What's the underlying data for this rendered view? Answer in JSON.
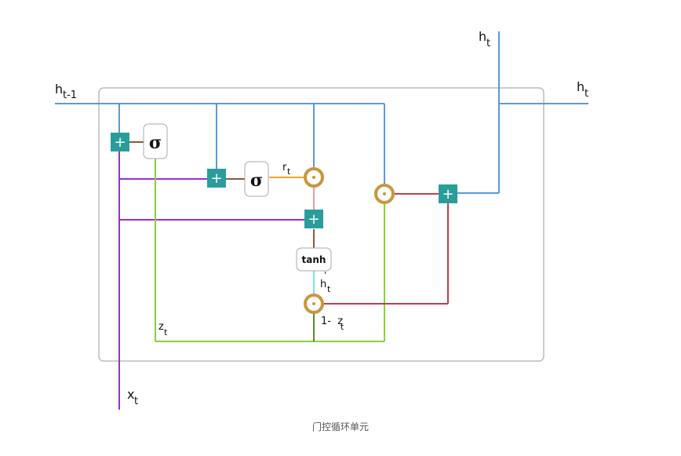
{
  "labels": {
    "h_prev_main": "h",
    "h_prev_sub": "t-1",
    "h_top_main": "h",
    "h_top_sub": "t",
    "h_right_main": "h",
    "h_right_sub": "t",
    "x_main": "x",
    "x_sub": "t",
    "r_main": "r",
    "r_sub": "t",
    "z_main": "z",
    "z_sub": "t",
    "h_cand_main": "h",
    "h_cand_sup": "'",
    "h_cand_sub": "t",
    "one_minus_z_main": "1-  z",
    "one_minus_z_sub": "t"
  },
  "boxes": {
    "sigma_1": "σ",
    "sigma_2": "σ",
    "tanh": "tanh"
  },
  "ops": {
    "plus": "+"
  },
  "colors": {
    "blue": "#5b9bd5",
    "purple": "#9b30c8",
    "green": "#8ccf3c",
    "dark_green": "#5c8a2e",
    "orange": "#f0a830",
    "pink": "#e89aa8",
    "red": "#c73c50",
    "cyan": "#7fe3d8",
    "brown": "#8a5a3a",
    "teal": "#2a9d9b",
    "gold": "#c8963e"
  },
  "caption": "门控循环单元"
}
